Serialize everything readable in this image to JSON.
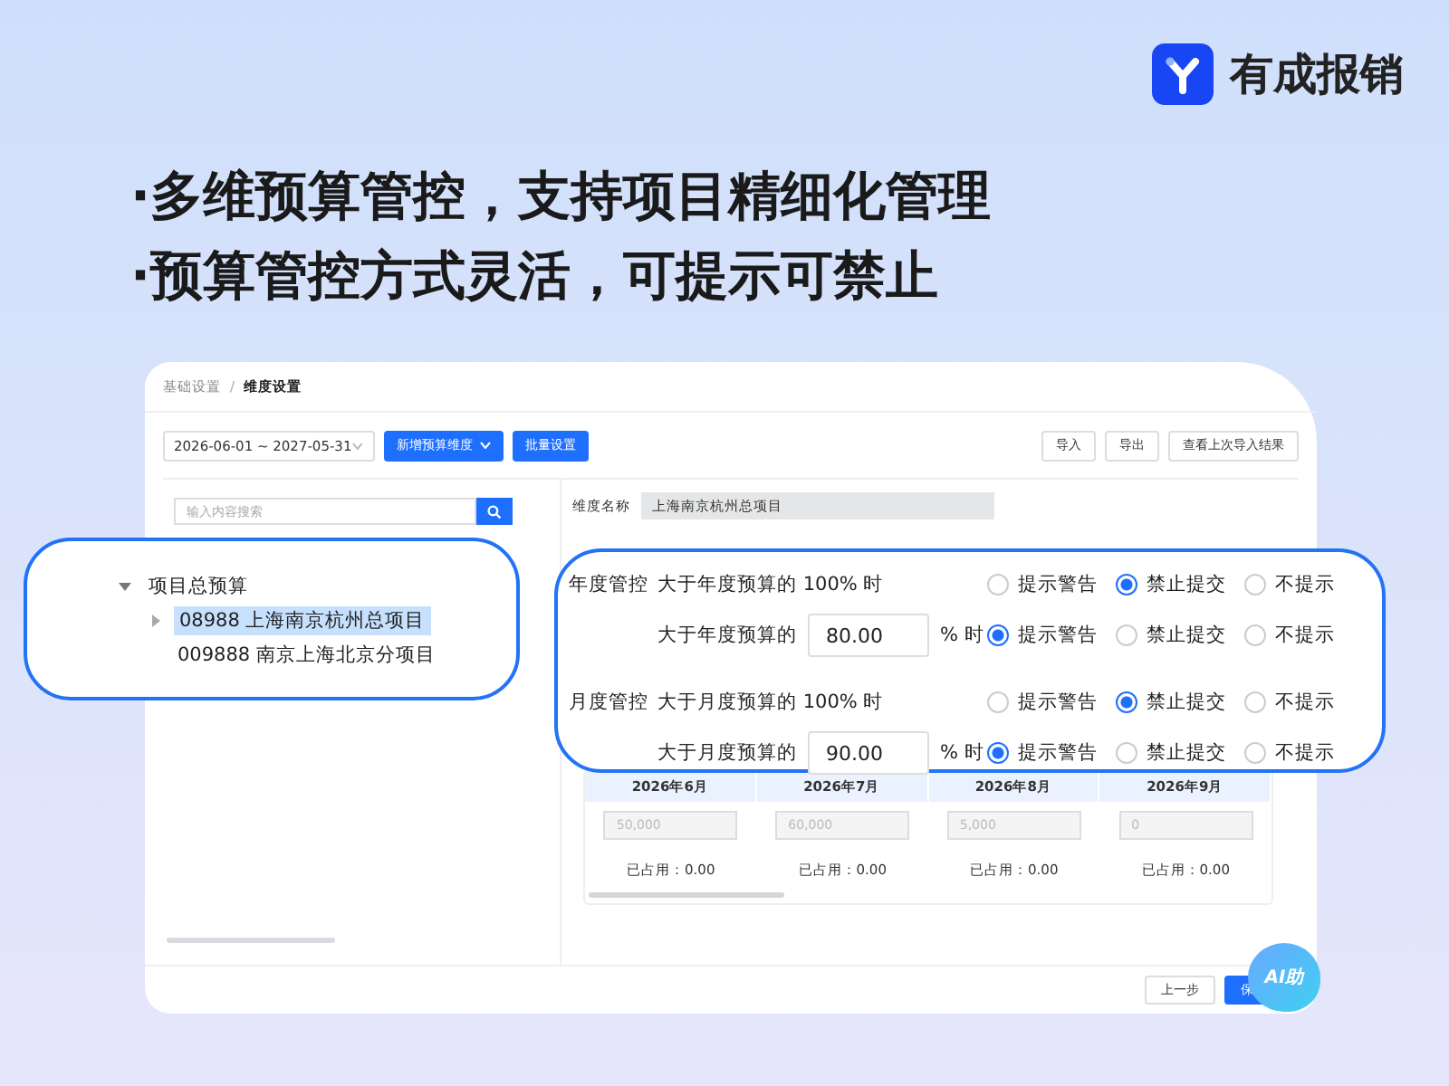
{
  "brand": {
    "name": "有成报销"
  },
  "headlines": [
    "·多维预算管控，支持项目精细化管理",
    "·预算管控方式灵活，可提示可禁止"
  ],
  "breadcrumb_separator": "/",
  "breadcrumb": [
    {
      "label": "基础设置",
      "current": false
    },
    {
      "label": "维度设置",
      "current": true
    }
  ],
  "toolbar": {
    "date_range": "2026-06-01 ~ 2027-05-31",
    "primary_buttons": [
      {
        "label": "新增预算维度",
        "dropdown": true
      },
      {
        "label": "批量设置",
        "dropdown": false
      }
    ],
    "buttons": [
      "导入",
      "导出",
      "查看上次导入结果"
    ]
  },
  "search": {
    "placeholder": "输入内容搜索"
  },
  "tree": [
    {
      "label": "项目总预算",
      "kind": "branch",
      "expanded": true,
      "selected": false,
      "children": [
        {
          "label": "08988 上海南京杭州总项目",
          "kind": "branch",
          "expanded": false,
          "selected": true
        },
        {
          "label": "009888 南京上海北京分项目",
          "kind": "leaf",
          "selected": false
        }
      ]
    }
  ],
  "form": {
    "fields": [
      {
        "label": "维度名称",
        "value": "上海南京杭州总项目"
      }
    ]
  },
  "controls": [
    {
      "title": "年度管控",
      "rules": [
        {
          "kind": "fixed",
          "text": "大于年度预算的 100% 时",
          "options": [
            {
              "label": "提示警告",
              "selected": false
            },
            {
              "label": "禁止提交",
              "selected": true
            },
            {
              "label": "不提示",
              "selected": false
            }
          ]
        },
        {
          "kind": "input",
          "prefix": "大于年度预算的",
          "value": "80.00",
          "suffix": "% 时",
          "options": [
            {
              "label": "提示警告",
              "selected": true
            },
            {
              "label": "禁止提交",
              "selected": false
            },
            {
              "label": "不提示",
              "selected": false
            }
          ]
        }
      ]
    },
    {
      "title": "月度管控",
      "rules": [
        {
          "kind": "fixed",
          "text": "大于月度预算的 100% 时",
          "options": [
            {
              "label": "提示警告",
              "selected": false
            },
            {
              "label": "禁止提交",
              "selected": true
            },
            {
              "label": "不提示",
              "selected": false
            }
          ]
        },
        {
          "kind": "input",
          "prefix": "大于月度预算的",
          "value": "90.00",
          "suffix": "% 时",
          "options": [
            {
              "label": "提示警告",
              "selected": true
            },
            {
              "label": "禁止提交",
              "selected": false
            },
            {
              "label": "不提示",
              "selected": false
            }
          ]
        }
      ]
    }
  ],
  "months": {
    "columns": [
      "2026年6月",
      "2026年7月",
      "2026年8月",
      "2026年9月"
    ],
    "amounts": [
      "50,000",
      "60,000",
      "5,000",
      "0"
    ],
    "used": [
      "已占用：0.00",
      "已占用：0.00",
      "已占用：0.00",
      "已占用：0.00"
    ]
  },
  "footer": {
    "buttons": [
      {
        "label": "上一步",
        "primary": false
      },
      {
        "label": "保",
        "primary": true
      }
    ]
  },
  "assistant": {
    "label": "AI助"
  }
}
